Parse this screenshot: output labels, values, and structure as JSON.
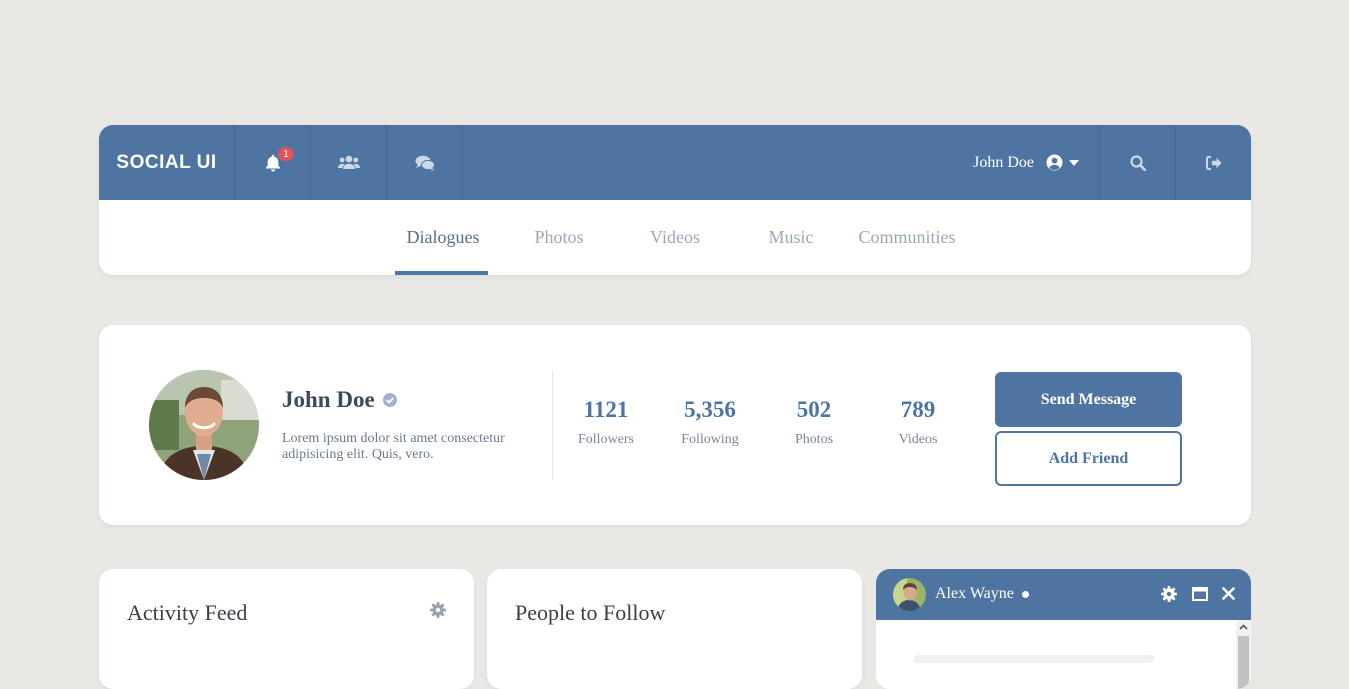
{
  "header": {
    "logo": "SOCIAL UI",
    "notification_count": "1",
    "user_name": "John Doe",
    "icons": [
      "bell-icon",
      "users-icon",
      "comments-icon",
      "user-circle-icon",
      "caret-down-icon",
      "search-icon",
      "sign-out-icon"
    ]
  },
  "tabs": [
    {
      "label": "Dialogues",
      "active": true
    },
    {
      "label": "Photos",
      "active": false
    },
    {
      "label": "Videos",
      "active": false
    },
    {
      "label": "Music",
      "active": false
    },
    {
      "label": "Communities",
      "active": false
    }
  ],
  "profile": {
    "name": "John Doe",
    "bio": "Lorem ipsum dolor sit amet consectetur adipisicing elit. Quis, vero.",
    "stats": [
      {
        "value": "1121",
        "label": "Followers"
      },
      {
        "value": "5,356",
        "label": "Following"
      },
      {
        "value": "502",
        "label": "Photos"
      },
      {
        "value": "789",
        "label": "Videos"
      }
    ],
    "primary_button": "Send Message",
    "secondary_button": "Add Friend"
  },
  "cards": {
    "activity_title": "Activity Feed",
    "people_title": "People to Follow"
  },
  "chat": {
    "name": "Alex Wayne",
    "status": "online"
  },
  "colors": {
    "accent": "#4e74a2",
    "background": "#e9e8e4",
    "badge": "#e2525c"
  }
}
